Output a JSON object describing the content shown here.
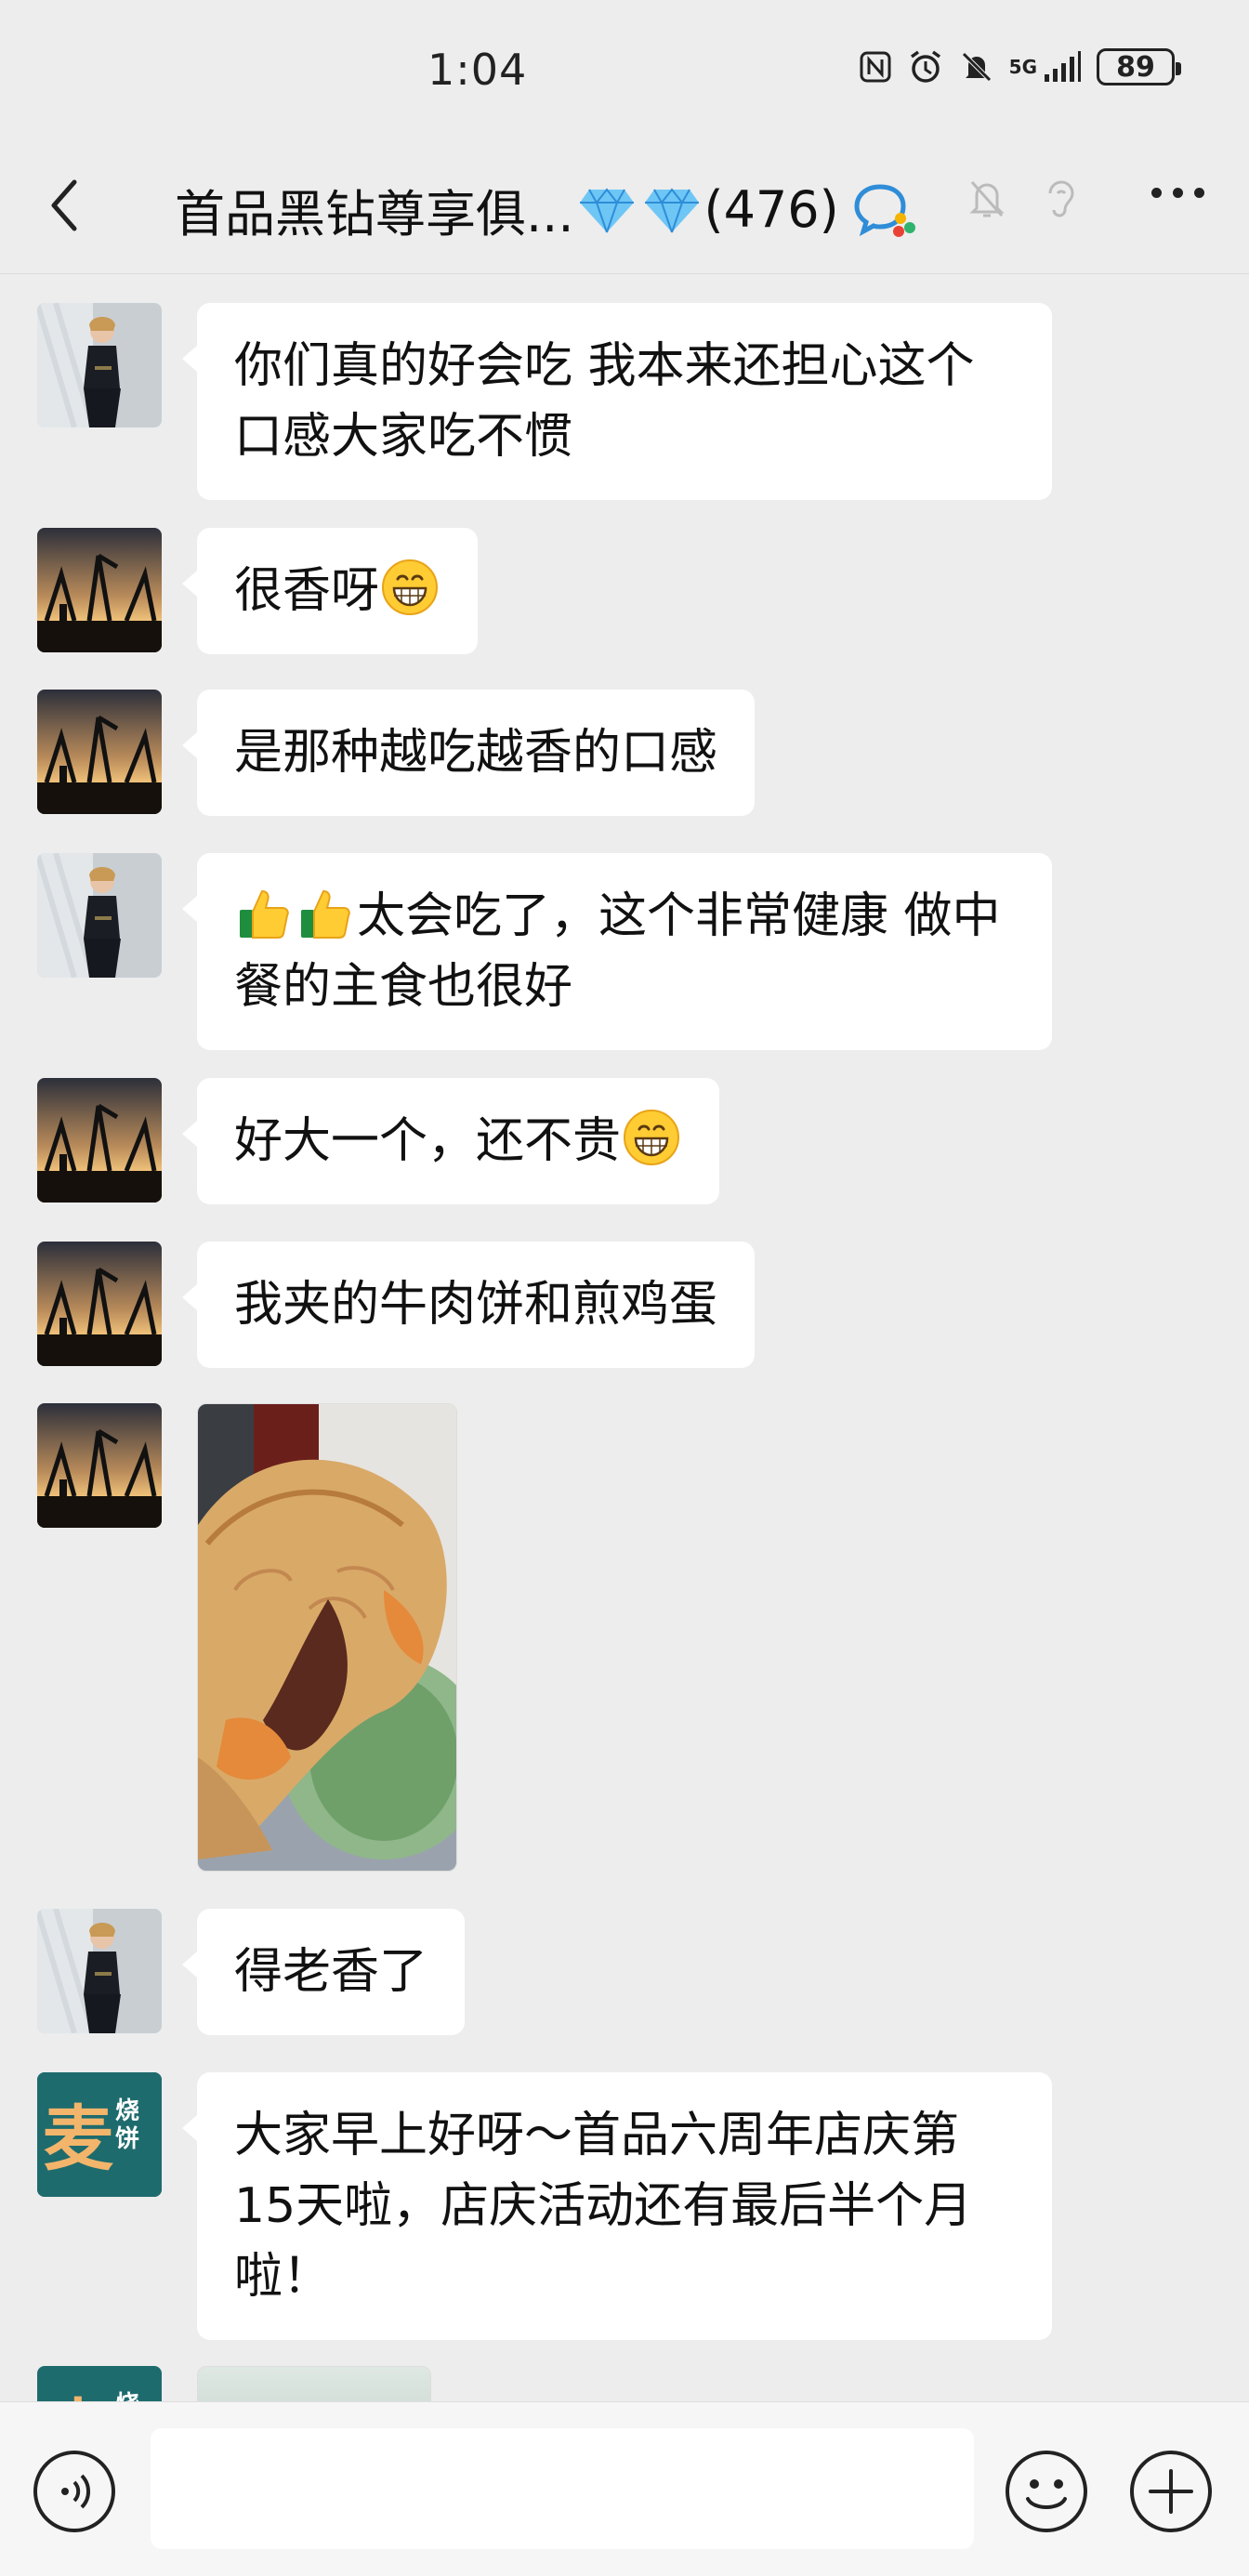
{
  "status": {
    "time": "1:04",
    "network": "5G",
    "battery": "89"
  },
  "header": {
    "title": "首品黑钻尊享俱...",
    "member_count": "(476)"
  },
  "messages": [
    {
      "avatar": "woman-black-outfit",
      "text": "你们真的好会吃 我本来还担心这个口感大家吃不惯"
    },
    {
      "avatar": "sunset-silhouette",
      "text": "很香呀"
    },
    {
      "avatar": "sunset-silhouette",
      "text": "是那种越吃越香的口感"
    },
    {
      "avatar": "woman-black-outfit",
      "text": "太会吃了，这个非常健康 做中餐的主食也很好"
    },
    {
      "avatar": "sunset-silhouette",
      "text": "好大一个，还不贵"
    },
    {
      "avatar": "sunset-silhouette",
      "text": "我夹的牛肉饼和煎鸡蛋"
    },
    {
      "avatar": "sunset-silhouette",
      "image": "beef-patty-flatbread-photo"
    },
    {
      "avatar": "woman-black-outfit",
      "text": "得老香了"
    },
    {
      "avatar": "mai-shaobing-logo",
      "text": "大家早上好呀～首品六周年店庆第15天啦，店庆活动还有最后半个月啦！"
    },
    {
      "avatar": "mai-shaobing-logo",
      "image": "partial-image"
    }
  ],
  "logo": {
    "big_char": "麦",
    "small_chars": "烧饼"
  },
  "input": {
    "placeholder": ""
  }
}
